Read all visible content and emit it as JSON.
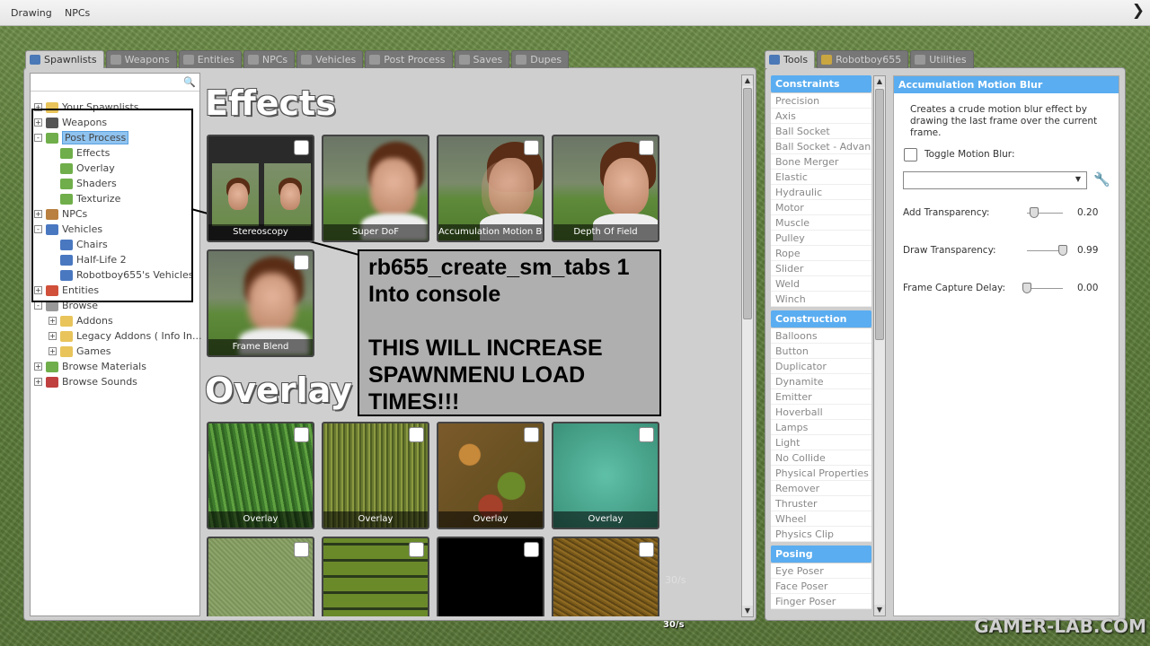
{
  "topbar": {
    "menus": [
      "Drawing",
      "NPCs"
    ]
  },
  "left_tabs": [
    {
      "label": "Spawnlists",
      "active": true
    },
    {
      "label": "Weapons",
      "active": false
    },
    {
      "label": "Entities",
      "active": false
    },
    {
      "label": "NPCs",
      "active": false
    },
    {
      "label": "Vehicles",
      "active": false
    },
    {
      "label": "Post Process",
      "active": false
    },
    {
      "label": "Saves",
      "active": false
    },
    {
      "label": "Dupes",
      "active": false
    }
  ],
  "right_tabs": [
    {
      "label": "Tools",
      "active": true
    },
    {
      "label": "Robotboy655",
      "active": false
    },
    {
      "label": "Utilities",
      "active": false
    }
  ],
  "tree": [
    {
      "label": "Your Spawnlists",
      "level": 0,
      "expander": "+",
      "icon": "folder-icon"
    },
    {
      "label": "Weapons",
      "level": 0,
      "expander": "+",
      "icon": "gun-icon"
    },
    {
      "label": "Post Process",
      "level": 0,
      "expander": "-",
      "icon": "image-icon",
      "selected": true
    },
    {
      "label": "Effects",
      "level": 1,
      "icon": "image-icon"
    },
    {
      "label": "Overlay",
      "level": 1,
      "icon": "image-icon"
    },
    {
      "label": "Shaders",
      "level": 1,
      "icon": "image-icon"
    },
    {
      "label": "Texturize",
      "level": 1,
      "icon": "image-icon"
    },
    {
      "label": "NPCs",
      "level": 0,
      "expander": "+",
      "icon": "monkey-icon"
    },
    {
      "label": "Vehicles",
      "level": 0,
      "expander": "-",
      "icon": "car-icon"
    },
    {
      "label": "Chairs",
      "level": 1,
      "icon": "car-icon"
    },
    {
      "label": "Half-Life 2",
      "level": 1,
      "icon": "car-icon"
    },
    {
      "label": "Robotboy655's Vehicles",
      "level": 1,
      "icon": "car-icon"
    },
    {
      "label": "Entities",
      "level": 0,
      "expander": "+",
      "icon": "bricks-icon"
    },
    {
      "label": "Browse",
      "level": 0,
      "expander": "-",
      "icon": "cog-icon"
    },
    {
      "label": "Addons",
      "level": 1,
      "expander": "+",
      "icon": "folder-icon"
    },
    {
      "label": "Legacy Addons ( Info In...",
      "level": 1,
      "expander": "+",
      "icon": "folder-icon"
    },
    {
      "label": "Games",
      "level": 1,
      "expander": "+",
      "icon": "folder-icon"
    },
    {
      "label": "Browse Materials",
      "level": 0,
      "expander": "+",
      "icon": "image-icon"
    },
    {
      "label": "Browse Sounds",
      "level": 0,
      "expander": "+",
      "icon": "speaker-icon"
    }
  ],
  "main": {
    "heading_effects": "Effects",
    "heading_overlay": "Overlay",
    "effects_tiles": [
      "Stereoscopy",
      "Super DoF",
      "Accumulation Motion Blur",
      "Depth Of Field",
      "Frame Blend"
    ],
    "overlay_tiles": [
      "Overlay",
      "Overlay",
      "Overlay",
      "Overlay"
    ],
    "annotation_lines": [
      "rb655_create_sm_tabs 1",
      "Into console",
      "",
      "THIS WILL INCREASE",
      "SPAWNMENU LOAD",
      "TIMES!!!"
    ]
  },
  "tool_categories": [
    {
      "name": "Constraints",
      "items": [
        "Precision",
        "Axis",
        "Ball Socket",
        "Ball Socket - Advan...",
        "Bone Merger",
        "Elastic",
        "Hydraulic",
        "Motor",
        "Muscle",
        "Pulley",
        "Rope",
        "Slider",
        "Weld",
        "Winch"
      ]
    },
    {
      "name": "Construction",
      "items": [
        "Balloons",
        "Button",
        "Duplicator",
        "Dynamite",
        "Emitter",
        "Hoverball",
        "Lamps",
        "Light",
        "No Collide",
        "Physical Properties",
        "Remover",
        "Thruster",
        "Wheel",
        "Physics Clip"
      ]
    },
    {
      "name": "Posing",
      "items": [
        "Eye Poser",
        "Face Poser",
        "Finger Poser"
      ]
    }
  ],
  "control_panel": {
    "title": "Accumulation Motion Blur",
    "description": "Creates a crude motion blur effect by drawing the last frame over the current frame.",
    "toggle_label": "Toggle Motion Blur:",
    "toggle_checked": false,
    "combo_value": "",
    "sliders": [
      {
        "label": "Add Transparency:",
        "value": "0.20",
        "fraction": 0.2
      },
      {
        "label": "Draw Transparency:",
        "value": "0.99",
        "fraction": 0.99
      },
      {
        "label": "Frame Capture Delay:",
        "value": "0.00",
        "fraction": 0.0
      }
    ]
  },
  "fps": "30/s",
  "watermark": "GAMER-LAB.COM",
  "colors": {
    "accent": "#5aadf0",
    "panel": "#cfcfcf",
    "grass": "#5d7d3a"
  }
}
